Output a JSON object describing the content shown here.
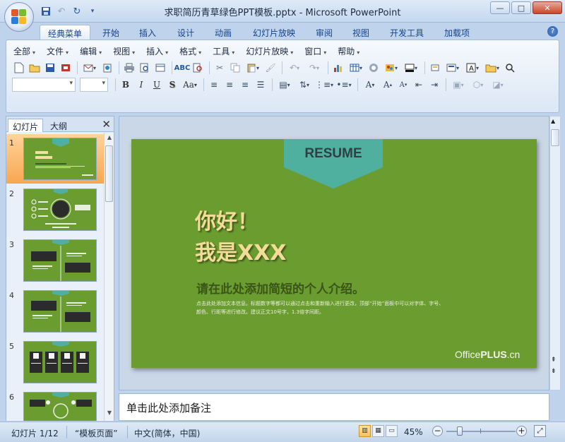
{
  "window": {
    "title": "求职简历青草绿色PPT模板.pptx - Microsoft PowerPoint",
    "controls": [
      "—",
      "□",
      "✕"
    ]
  },
  "ribbon_tabs": [
    "经典菜单",
    "开始",
    "插入",
    "设计",
    "动画",
    "幻灯片放映",
    "审阅",
    "视图",
    "开发工具",
    "加载项"
  ],
  "classic_menu": [
    "全部",
    "文件",
    "编辑",
    "视图",
    "插入",
    "格式",
    "工具",
    "幻灯片放映",
    "窗口",
    "帮助"
  ],
  "format_buttons": [
    "B",
    "I",
    "U",
    "S",
    "Aa"
  ],
  "panel": {
    "tabs": [
      "幻灯片",
      "大纲"
    ],
    "close": "✕",
    "slide_numbers": [
      "1",
      "2",
      "3",
      "4",
      "5",
      "6"
    ]
  },
  "slide": {
    "banner": "RESUME",
    "greeting": "你好！",
    "name_line": "我是XXX",
    "subtitle": "请在此处添加简短的个人介绍。",
    "body_line1": "点击此处添加文本信息。标题数字等都可以通过点击和重新输入进行更改，顶部“开始”面板中可以对字体、字号、",
    "body_line2": "颜色、行距等进行修改。建议正文10号字，1.3倍字间距。",
    "brand_main": "Office",
    "brand_bold": "PLUS",
    "brand_suffix": ".cn",
    "bg_color": "#6b9c2f",
    "banner_color": "#4fb0a0"
  },
  "notes_placeholder": "单击此处添加备注",
  "status": {
    "slide_counter": "幻灯片 1/12",
    "theme": "“模板页面”",
    "language": "中文(简体，中国)",
    "zoom": "45%"
  }
}
